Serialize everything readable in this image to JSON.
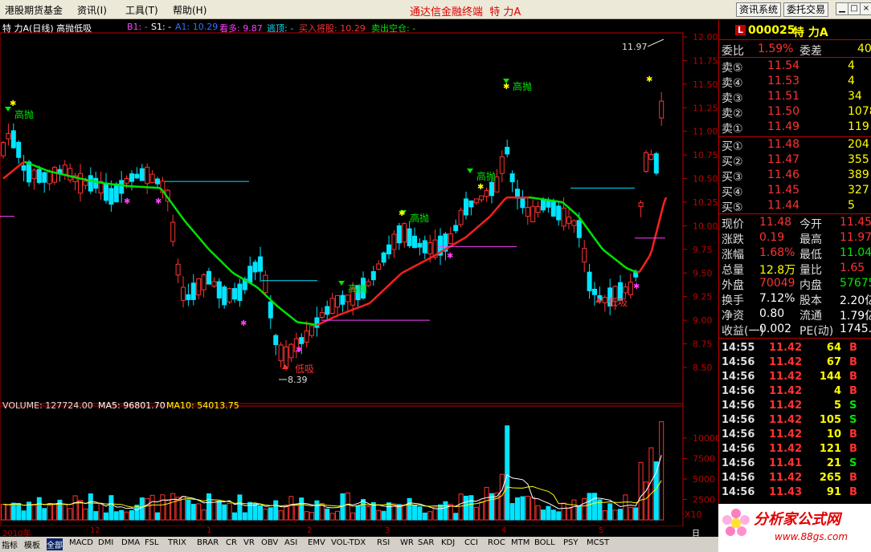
{
  "menu": {
    "items": [
      {
        "label": "港股期货基金"
      },
      {
        "label": "资讯(I)"
      },
      {
        "label": "工具(T)"
      },
      {
        "label": "帮助(H)"
      }
    ],
    "app_title": "通达信金融终端",
    "stock_short": "特  力A",
    "btn_info": "资讯系统",
    "btn_order": "委托交易",
    "win_min": "▁",
    "win_max": "□",
    "win_close": "×"
  },
  "info": {
    "name": "特  力A(日线) 高抛低吸",
    "b1": "B1: -",
    "s1": "S1: -",
    "a1": "A1: 10.29",
    "kanduo": "看多: 9.87",
    "taoding": "逃顶: -",
    "buy": "买入将股: 10.29",
    "sell": "卖出空仓: -"
  },
  "price_chart": {
    "yticks": [
      "12.00",
      "11.75",
      "11.50",
      "11.25",
      "11.00",
      "10.75",
      "10.50",
      "10.25",
      "10.00",
      "9.75",
      "9.50",
      "9.25",
      "9.00",
      "8.75",
      "8.50"
    ],
    "hi_label": "11.97",
    "lo_label": "8.39",
    "labels": {
      "gaopao": "高抛",
      "dixi": "低吸"
    }
  },
  "volume": {
    "header": "VOLUME: 127724.00",
    "ma5": "MA5: 96801.70",
    "ma10": "MA10: 54013.75",
    "yticks": [
      "10000",
      "7500",
      "5000",
      "2500"
    ],
    "unit": "X10"
  },
  "xaxis": {
    "labels": [
      "2010年",
      "12",
      "1",
      "2",
      "3",
      "4",
      "5"
    ],
    "period": "日线"
  },
  "right_panel": {
    "code": "000025",
    "name": "特  力A",
    "l": "L",
    "weibi": {
      "label": "委比",
      "value": "1.59%",
      "label2": "委差",
      "value2": "40"
    },
    "asks": [
      {
        "label": "卖⑤",
        "price": "11.54",
        "vol": "4"
      },
      {
        "label": "卖④",
        "price": "11.53",
        "vol": "4"
      },
      {
        "label": "卖③",
        "price": "11.51",
        "vol": "34"
      },
      {
        "label": "卖②",
        "price": "11.50",
        "vol": "1078"
      },
      {
        "label": "卖①",
        "price": "11.49",
        "vol": "119"
      }
    ],
    "bids": [
      {
        "label": "买①",
        "price": "11.48",
        "vol": "204"
      },
      {
        "label": "买②",
        "price": "11.47",
        "vol": "355"
      },
      {
        "label": "买③",
        "price": "11.46",
        "vol": "389"
      },
      {
        "label": "买④",
        "price": "11.45",
        "vol": "327"
      },
      {
        "label": "买⑤",
        "price": "11.44",
        "vol": "5"
      }
    ],
    "stats": [
      {
        "l1": "现价",
        "v1": "11.48",
        "l2": "今开",
        "v2": "11.45"
      },
      {
        "l1": "涨跌",
        "v1": "0.19",
        "l2": "最高",
        "v2": "11.97"
      },
      {
        "l1": "涨幅",
        "v1": "1.68%",
        "l2": "最低",
        "v2": "11.04"
      },
      {
        "l1": "总量",
        "v1": "12.8万",
        "l2": "量比",
        "v2": "1.65"
      },
      {
        "l1": "外盘",
        "v1": "70049",
        "l2": "内盘",
        "v2": "57675"
      },
      {
        "l1": "换手",
        "v1": "7.12%",
        "l2": "股本",
        "v2": "2.20亿"
      },
      {
        "l1": "净资",
        "v1": "0.80",
        "l2": "流通",
        "v2": "1.79亿"
      },
      {
        "l1": "收益(一)",
        "v1": "0.002",
        "l2": "PE(动)",
        "v2": "1745.9"
      }
    ],
    "ticks": [
      {
        "t": "14:55",
        "p": "11.42",
        "v": "64",
        "s": "B"
      },
      {
        "t": "14:56",
        "p": "11.42",
        "v": "67",
        "s": "B"
      },
      {
        "t": "14:56",
        "p": "11.42",
        "v": "144",
        "s": "B"
      },
      {
        "t": "14:56",
        "p": "11.42",
        "v": "4",
        "s": "B"
      },
      {
        "t": "14:56",
        "p": "11.42",
        "v": "5",
        "s": "S"
      },
      {
        "t": "14:56",
        "p": "11.42",
        "v": "105",
        "s": "S"
      },
      {
        "t": "14:56",
        "p": "11.42",
        "v": "10",
        "s": "B"
      },
      {
        "t": "14:56",
        "p": "11.42",
        "v": "121",
        "s": "B"
      },
      {
        "t": "14:56",
        "p": "11.41",
        "v": "21",
        "s": "S"
      },
      {
        "t": "14:56",
        "p": "11.42",
        "v": "265",
        "s": "B"
      },
      {
        "t": "14:56",
        "p": "11.43",
        "v": "91",
        "s": "B"
      }
    ]
  },
  "bottom_tabs": [
    "指标",
    "模板",
    "全部",
    "MACD",
    "DMI",
    "DMA",
    "FSL",
    "TRIX",
    "BRAR",
    "CR",
    "VR",
    "OBV",
    "ASI",
    "EMV",
    "VOL-TDX",
    "RSI",
    "WR",
    "SAR",
    "KDJ",
    "CCI",
    "ROC",
    "MTM",
    "BOLL",
    "PSY",
    "MCST"
  ],
  "logo": {
    "text": "分析家公式网",
    "url": "www.88gs.com"
  },
  "colors": {
    "up": "#ff3232",
    "down": "#00e4ff",
    "ma_green": "#00e600",
    "ma_red": "#ff2020",
    "axis": "#c00000"
  }
}
